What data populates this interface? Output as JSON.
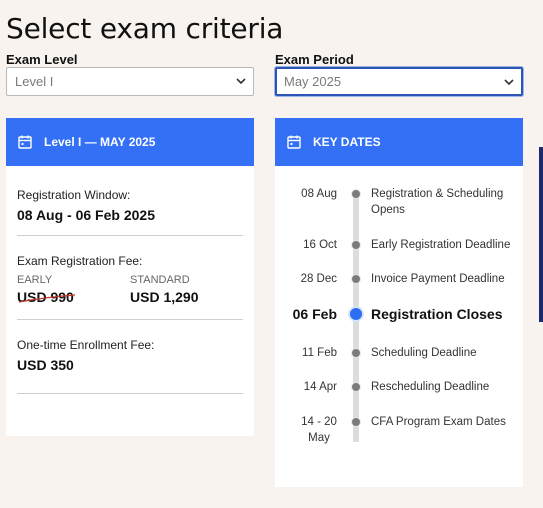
{
  "page": {
    "title": "Select exam criteria"
  },
  "filters": {
    "level": {
      "label": "Exam Level",
      "value": "Level I"
    },
    "period": {
      "label": "Exam Period",
      "value": "May 2025"
    }
  },
  "summary_card": {
    "header": "Level I — MAY 2025",
    "icon": "calendar-icon",
    "registration_window": {
      "label": "Registration Window:",
      "value": "08 Aug - 06 Feb 2025"
    },
    "exam_fee": {
      "label": "Exam Registration Fee:",
      "early": {
        "tag": "EARLY",
        "value": "USD 990",
        "struck": true
      },
      "standard": {
        "tag": "STANDARD",
        "value": "USD 1,290"
      }
    },
    "enrollment_fee": {
      "label": "One-time Enrollment Fee:",
      "value": "USD 350"
    }
  },
  "key_dates_card": {
    "header": "KEY DATES",
    "icon": "calendar-icon",
    "events": [
      {
        "date": "08 Aug",
        "text": "Registration & Scheduling Opens"
      },
      {
        "date": "16 Oct",
        "text": "Early Registration Deadline"
      },
      {
        "date": "28 Dec",
        "text": "Invoice Payment Deadline"
      },
      {
        "date": "06 Feb",
        "text": "Registration Closes",
        "highlight": true
      },
      {
        "date": "11 Feb",
        "text": "Scheduling Deadline"
      },
      {
        "date": "14 Apr",
        "text": "Rescheduling Deadline"
      },
      {
        "date": "14 - 20 May",
        "text": "CFA Program Exam Dates"
      }
    ]
  },
  "colors": {
    "accent": "#3370f5",
    "background": "#f8f3ee",
    "edge": "#1e2a6e"
  }
}
